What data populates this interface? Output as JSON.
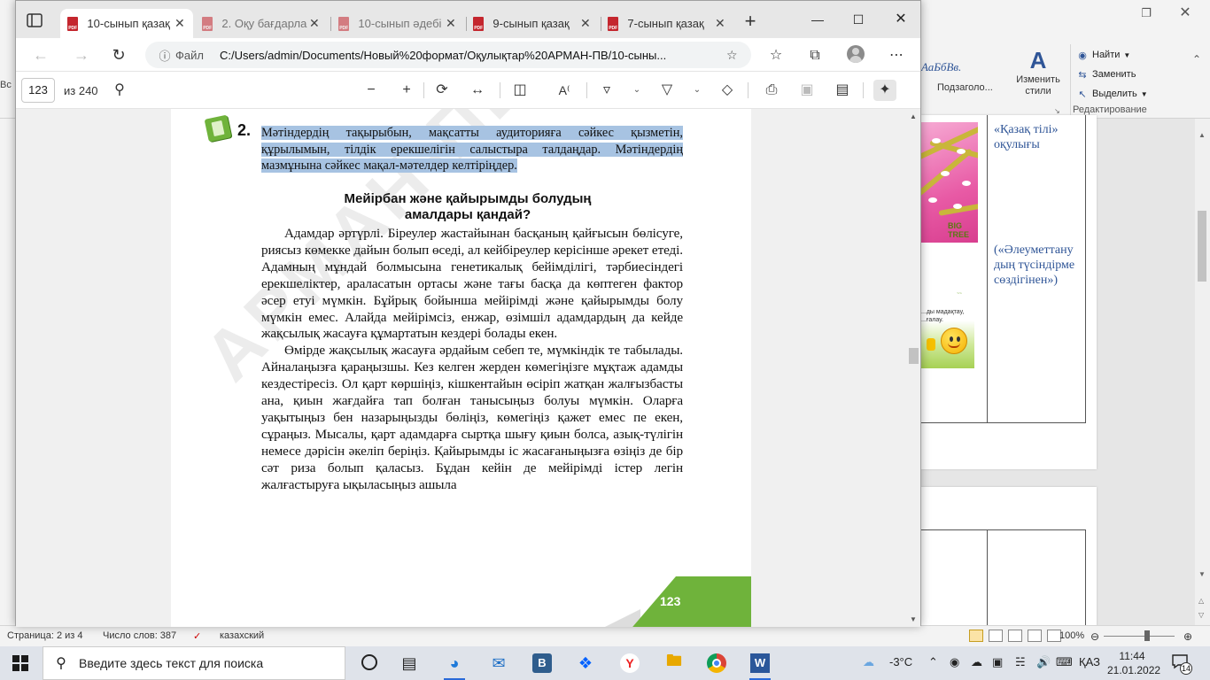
{
  "word": {
    "ribbon_partial_label": "Вс",
    "styles_preview": "АаБбВв.",
    "styles_name": "Подзаголо...",
    "change_styles_label": "Изменить стили",
    "edit": {
      "find": "Найти",
      "replace": "Заменить",
      "select": "Выделить",
      "group_label": "Редактирование"
    },
    "cell_note_1": "«Қазақ тілі» оқулығы",
    "cell_note_2": "(«Әлеуметтану дың түсіндірме сөздігінен»)",
    "image_tag": "BIG TREE",
    "image_caption": "...ды мадақтау, ...ғалау.",
    "status": {
      "page": "Страница: 2 из 4",
      "words": "Число слов: 387",
      "language": "казахский",
      "zoom": "100%"
    }
  },
  "browser": {
    "tabs": [
      {
        "title": "10-сынып қазақ",
        "active": true
      },
      {
        "title": "2. Оқу бағдарла",
        "active": false
      },
      {
        "title": "10-сынып әдебі",
        "active": false
      },
      {
        "title": "9-сынып қазақ",
        "active": false
      },
      {
        "title": "7-сынып қазақ",
        "active": false
      }
    ],
    "url_label": "Файл",
    "url": "C:/Users/admin/Documents/Новый%20формат/Оқулықтар%20АРМАН-ПВ/10-сыны...",
    "pdf": {
      "page_current": "123",
      "page_total": "из 240"
    }
  },
  "page": {
    "task_number": "2.",
    "task_text": "Мәтіндердің тақырыбын, мақсатты аудиторияға сәйкес қызметін, құрылымын, тілдік ерекшелігін салыстыра талдаңдар. Мәтіндердің мазмұнына сәйкес мақал-мәтелдер келтіріңдер.",
    "title_line1": "Мейірбан және қайырымды болудың",
    "title_line2": "амалдары қандай?",
    "paragraph1": "Адамдар әртүрлі. Біреулер жастайынан басқаның қайғысын бөлісуге, риясыз көмекке дайын болып өседі, ал кейбіреулер керісінше әрекет етеді. Адамның мұндай болмысына генетикалық бейімділігі, тәрбиесіндегі ерекшеліктер, араласатын ортасы және тағы басқа да көптеген фактор әсер етуі мүмкін. Бұйрық бойынша мейірімді және қайырымды болу мүмкін емес. Алайда мейірімсіз, енжар, өзімшіл адамдардың да кейде жақсылық жасауға құмартатын кездері болады екен.",
    "paragraph2": "Өмірде жақсылық жасауға әрдайым себеп те, мүмкіндік те табылады. Айналаңызға қараңызшы. Кез келген жерден көмегіңізге мұқтаж адамды кездестіресіз. Ол қарт көршіңіз, кішкентайын өсіріп жатқан жалғызбасты ана, қиын жағдайға тап болған танысыңыз болуы мүмкін. Оларға уақытыңыз бен назарыңызды бөліңіз, көмегіңіз қажет емес пе екен, сұраңыз. Мысалы, қарт адамдарға сыртқа шығу қиын болса, азық-түлігін немесе дәрісін әкеліп беріңіз. Қайырымды іс жасағаныңызға өзіңіз де бір сәт риза болып қаласыз. Бұдан кейін де мейірімді істер легін жалғастыруға ықыласыңыз ашыла",
    "page_number": "123",
    "watermark": "АРМАН-ПВ"
  },
  "taskbar": {
    "search_placeholder": "Введите здесь текст для поиска",
    "temperature": "-3°C",
    "language": "ҚАЗ",
    "time": "11:44",
    "date": "21.01.2022",
    "notification_count": "14"
  }
}
